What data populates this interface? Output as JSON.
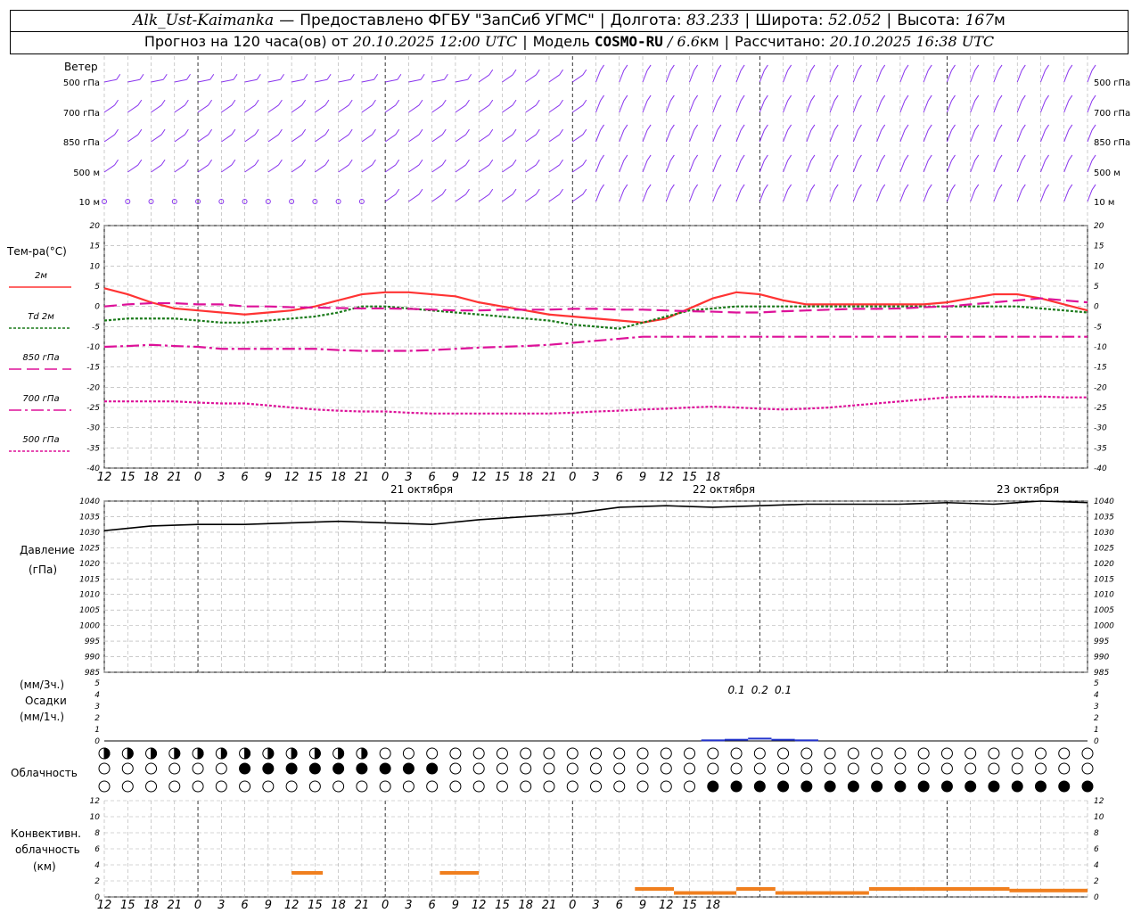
{
  "header": {
    "station": "Alk_Ust-Kaimanka",
    "provider": "Предоставлено ФГБУ \"ЗапСиб УГМС\"",
    "lon_label": "Долгота:",
    "lon": "83.233",
    "lat_label": "Широта:",
    "lat": "52.052",
    "alt_label": "Высота:",
    "alt": "167",
    "alt_unit": "м",
    "forecast_label": "Прогноз на 120 часа(ов)  от",
    "forecast_time": "20.10.2025 12:00 UTC",
    "model_label": "Модель",
    "model": "COSMO-RU",
    "model_res": "/ 6.6",
    "model_res_unit": "км",
    "calc_label": "Рассчитано:",
    "calc_time": "20.10.2025 16:38 UTC"
  },
  "panels": {
    "wind": {
      "title": "Ветер",
      "levels": [
        "500 гПа",
        "700 гПа",
        "850 гПа",
        "500 м",
        "10  м"
      ]
    },
    "temp": {
      "title": "Тем-ра(°C)",
      "legend": [
        {
          "label": "2м",
          "color": "#ff3333"
        },
        {
          "label": "Td  2м",
          "color": "#1a7a1a"
        },
        {
          "label": "850 гПа",
          "color": "#dd1199"
        },
        {
          "label": "700 гПа",
          "color": "#dd1199"
        },
        {
          "label": "500 гПа",
          "color": "#dd1199"
        }
      ],
      "yticks": [
        "20",
        "15",
        "10",
        "5",
        "0",
        "-5",
        "-10",
        "-15",
        "-20",
        "-25",
        "-30",
        "-35",
        "-40"
      ]
    },
    "pressure": {
      "title": "Давление",
      "unit": "(гПа)",
      "yticks": [
        "1040",
        "1035",
        "1030",
        "1025",
        "1020",
        "1015",
        "1010",
        "1005",
        "1000",
        "995",
        "990",
        "985"
      ]
    },
    "precip": {
      "unit1": "(мм/3ч.)",
      "title": "Осадки",
      "unit2": "(мм/1ч.)",
      "yticks": [
        "5",
        "4",
        "3",
        "2",
        "1",
        "0"
      ],
      "labels": [
        "0.1",
        "0.2",
        "0.1"
      ]
    },
    "cloud": {
      "title": "Облачность"
    },
    "conv": {
      "title1": "Конвективн.",
      "title2": "облачность",
      "unit": "(км)",
      "yticks": [
        "12",
        "10",
        "8",
        "6",
        "4",
        "2",
        "0"
      ]
    }
  },
  "x_axis": {
    "hour_labels": [
      "12",
      "15",
      "18",
      "21",
      "0",
      "3",
      "6",
      "9",
      "12",
      "15",
      "18",
      "21",
      "0",
      "3",
      "6",
      "9",
      "12",
      "15",
      "18",
      "21",
      "0",
      "3",
      "6",
      "9",
      "12",
      "15",
      "18"
    ],
    "dates": [
      "21 октября",
      "22 октября",
      "23 октября"
    ]
  },
  "chart_data": [
    {
      "type": "line",
      "title": "Тем-ра(°C)",
      "x_hours": [
        0,
        3,
        6,
        9,
        12,
        15,
        18,
        21,
        24,
        27,
        30,
        33,
        36,
        39,
        42,
        45,
        48,
        51,
        54,
        57,
        60,
        63,
        66,
        69,
        72,
        75,
        78,
        81,
        84,
        87,
        90,
        93,
        96,
        99,
        102,
        105,
        108,
        111,
        114,
        117,
        120,
        123,
        126
      ],
      "ylim": [
        -40,
        20
      ],
      "series": [
        {
          "name": "2м",
          "color": "#ff3333",
          "dash": "",
          "values": [
            4.5,
            3,
            1,
            -0.5,
            -1,
            -1.5,
            -2,
            -1.5,
            -1,
            0,
            1.5,
            3,
            3.5,
            3.5,
            3,
            2.5,
            1,
            0,
            -1,
            -2,
            -2.5,
            -3,
            -3.5,
            -4,
            -3,
            -0.5,
            2,
            3.5,
            3,
            1.5,
            0.5,
            0.5,
            0.5,
            0.5,
            0.5,
            0.5,
            1,
            2,
            3,
            3,
            2,
            0.5,
            -1
          ]
        },
        {
          "name": "Td  2м",
          "color": "#1a7a1a",
          "dash": "3,2",
          "values": [
            -3.5,
            -3,
            -3,
            -3,
            -3.5,
            -4,
            -4,
            -3.5,
            -3,
            -2.5,
            -1.5,
            0,
            0,
            -0.5,
            -1,
            -1.5,
            -2,
            -2.5,
            -3,
            -3.5,
            -4.5,
            -5,
            -5.5,
            -4,
            -2.5,
            -1,
            -0.5,
            0,
            0,
            0,
            0,
            0,
            0,
            0,
            0,
            0,
            0,
            0,
            0,
            0,
            -0.5,
            -1,
            -1.5
          ]
        },
        {
          "name": "850 гПа",
          "color": "#dd1199",
          "dash": "14,6",
          "values": [
            0,
            0.5,
            0.8,
            0.8,
            0.5,
            0.5,
            0,
            0,
            -0.2,
            -0.3,
            -0.4,
            -0.5,
            -0.5,
            -0.6,
            -0.8,
            -1,
            -1,
            -0.8,
            -0.8,
            -0.8,
            -0.6,
            -0.6,
            -0.8,
            -0.8,
            -1,
            -1.2,
            -1.3,
            -1.5,
            -1.5,
            -1.2,
            -1,
            -0.8,
            -0.6,
            -0.6,
            -0.5,
            -0.2,
            0,
            0.5,
            1,
            1.5,
            2,
            1.5,
            1
          ]
        },
        {
          "name": "700 гПа",
          "color": "#dd1199",
          "dash": "14,4,3,4",
          "values": [
            -10,
            -9.8,
            -9.5,
            -9.8,
            -10,
            -10.5,
            -10.5,
            -10.5,
            -10.5,
            -10.5,
            -10.8,
            -11,
            -11,
            -11,
            -10.8,
            -10.5,
            -10.2,
            -10,
            -9.8,
            -9.5,
            -9,
            -8.5,
            -8,
            -7.5,
            -7.5,
            -7.5,
            -7.5,
            -7.5,
            -7.5,
            -7.5,
            -7.5,
            -7.5,
            -7.5,
            -7.5,
            -7.5,
            -7.5,
            -7.5,
            -7.5,
            -7.5,
            -7.5,
            -7.5,
            -7.5,
            -7.5
          ]
        },
        {
          "name": "500 гПа",
          "color": "#dd1199",
          "dash": "3,2",
          "values": [
            -23.5,
            -23.5,
            -23.5,
            -23.5,
            -23.8,
            -24,
            -24,
            -24.5,
            -25,
            -25.5,
            -25.8,
            -26,
            -26,
            -26.3,
            -26.5,
            -26.5,
            -26.5,
            -26.5,
            -26.5,
            -26.5,
            -26.3,
            -26,
            -25.8,
            -25.5,
            -25.3,
            -25,
            -24.8,
            -25,
            -25.3,
            -25.5,
            -25.3,
            -25,
            -24.5,
            -24,
            -23.5,
            -23,
            -22.5,
            -22.3,
            -22.3,
            -22.5,
            -22.3,
            -22.5,
            -22.5
          ]
        }
      ]
    },
    {
      "type": "line",
      "title": "Давление",
      "x_hours": [
        0,
        6,
        12,
        18,
        24,
        30,
        36,
        42,
        48,
        54,
        60,
        66,
        72,
        78,
        84,
        90,
        96,
        102,
        108,
        114,
        120,
        126
      ],
      "ylim": [
        985,
        1040
      ],
      "series": [
        {
          "name": "",
          "color": "#000000",
          "dash": "",
          "values": [
            1030.5,
            1032,
            1032.5,
            1032.5,
            1033,
            1033.5,
            1033,
            1032.5,
            1034,
            1035,
            1036,
            1038,
            1038.5,
            1038,
            1038.5,
            1039,
            1039,
            1039,
            1039.5,
            1039,
            1040,
            1039.5
          ]
        }
      ]
    },
    {
      "type": "bar",
      "title": "Осадки",
      "x_hours": [
        78,
        81,
        84,
        87,
        90
      ],
      "ylim": [
        0,
        5
      ],
      "values": [
        0.05,
        0.1,
        0.2,
        0.1,
        0.05
      ],
      "labels_at_hours": [
        81,
        84,
        87
      ]
    },
    {
      "type": "bar",
      "title": "Конвективн. облачность",
      "ylim": [
        0,
        12
      ],
      "segments": [
        {
          "from_h": 24,
          "to_h": 28,
          "height_km": 3
        },
        {
          "from_h": 43,
          "to_h": 48,
          "height_km": 3
        },
        {
          "from_h": 68,
          "to_h": 73,
          "height_km": 1
        },
        {
          "from_h": 73,
          "to_h": 81,
          "height_km": 0.5
        },
        {
          "from_h": 81,
          "to_h": 86,
          "height_km": 1
        },
        {
          "from_h": 86,
          "to_h": 98,
          "height_km": 0.5
        },
        {
          "from_h": 98,
          "to_h": 104,
          "height_km": 1
        },
        {
          "from_h": 104,
          "to_h": 116,
          "height_km": 1
        },
        {
          "from_h": 116,
          "to_h": 126,
          "height_km": 0.8
        }
      ]
    }
  ]
}
